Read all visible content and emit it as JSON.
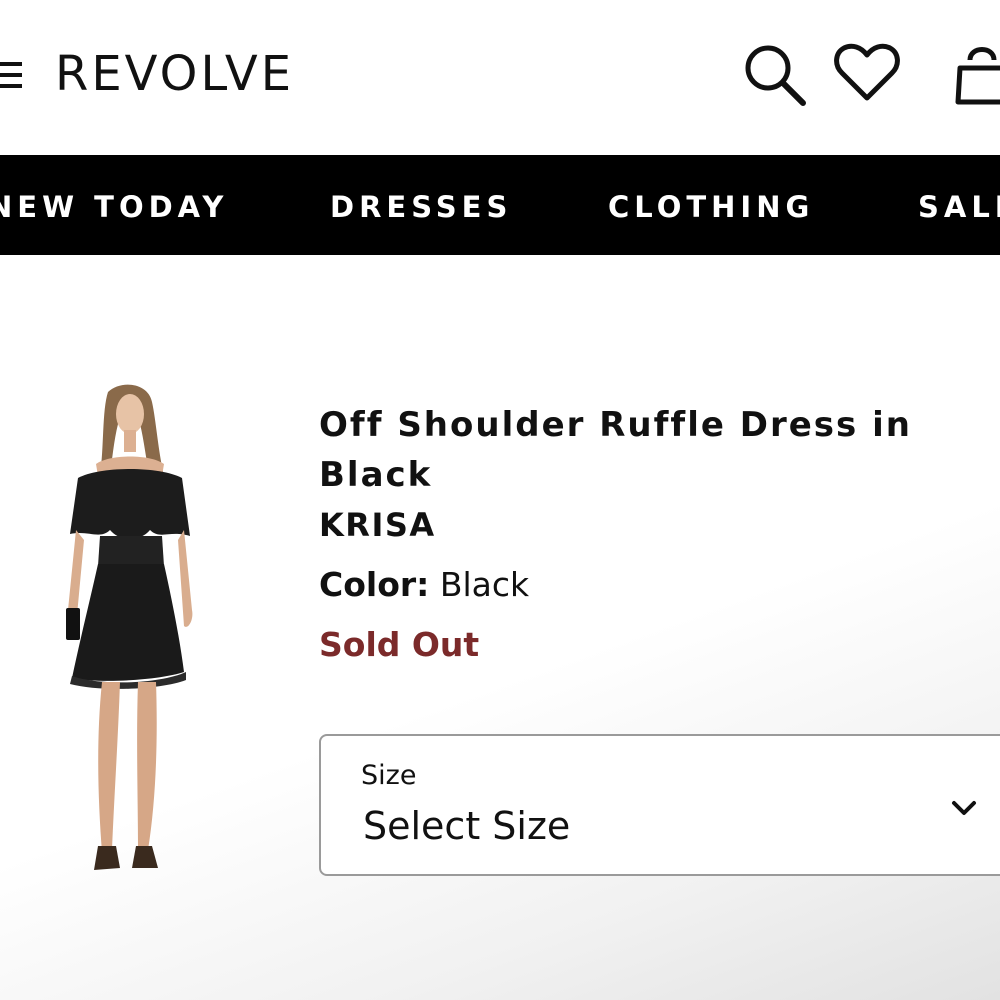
{
  "header": {
    "logo_text": "REVOLVE",
    "icons": [
      "menu-icon",
      "search-icon",
      "heart-icon",
      "bag-icon"
    ]
  },
  "nav": {
    "items": [
      {
        "label": "NEW TODAY"
      },
      {
        "label": "DRESSES"
      },
      {
        "label": "CLOTHING"
      },
      {
        "label": "SALE"
      }
    ]
  },
  "product": {
    "title": "Off Shoulder Ruffle Dress in Black",
    "brand": "KRISA",
    "color_label": "Color:",
    "color_value": "Black",
    "status": "Sold Out",
    "status_color": "#7b2a2a"
  },
  "size_select": {
    "label": "Size",
    "value": "Select Size"
  },
  "colors": {
    "nav_background": "#000000",
    "nav_text": "#ffffff",
    "text": "#111111"
  }
}
